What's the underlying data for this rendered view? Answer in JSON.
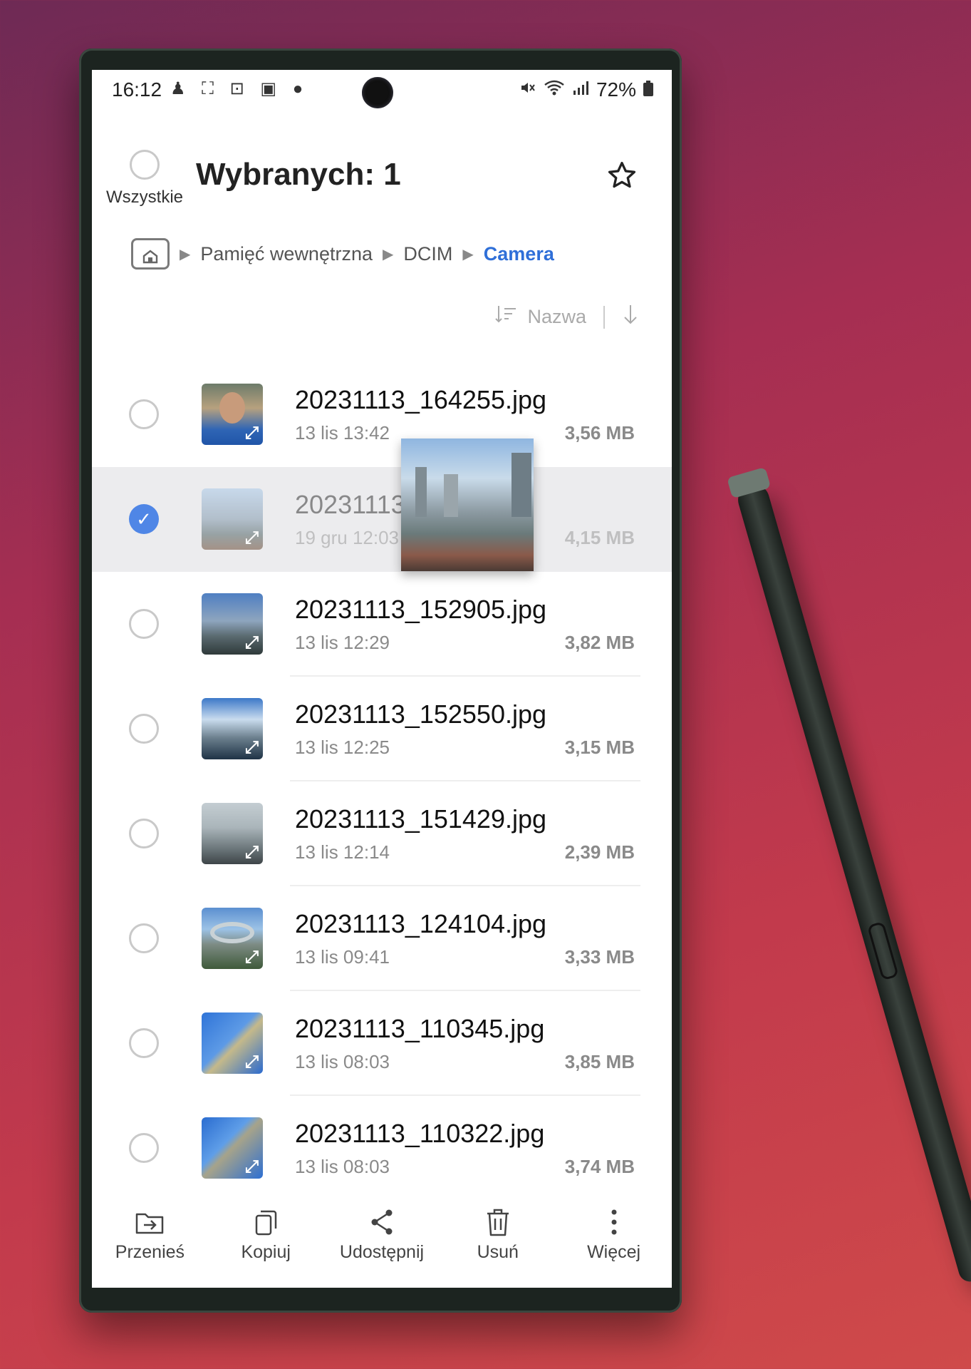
{
  "status": {
    "time": "16:12",
    "icons_left": "♟ ⛶ ⊡ ▣ ●",
    "battery": "72%"
  },
  "header": {
    "select_all_label": "Wszystkie",
    "title": "Wybranych: 1"
  },
  "breadcrumb": {
    "items": [
      "Pamięć wewnętrzna",
      "DCIM",
      "Camera"
    ]
  },
  "sort": {
    "label": "Nazwa"
  },
  "files": [
    {
      "name": "20231113_164255.jpg",
      "date": "13 lis 13:42",
      "size": "3,56 MB",
      "selected": false
    },
    {
      "name": "20231113",
      "date": "19 gru 12:03",
      "size": "4,15 MB",
      "selected": true
    },
    {
      "name": "20231113_152905.jpg",
      "date": "13 lis 12:29",
      "size": "3,82 MB",
      "selected": false
    },
    {
      "name": "20231113_152550.jpg",
      "date": "13 lis 12:25",
      "size": "3,15 MB",
      "selected": false
    },
    {
      "name": "20231113_151429.jpg",
      "date": "13 lis 12:14",
      "size": "2,39 MB",
      "selected": false
    },
    {
      "name": "20231113_124104.jpg",
      "date": "13 lis 09:41",
      "size": "3,33 MB",
      "selected": false
    },
    {
      "name": "20231113_110345.jpg",
      "date": "13 lis 08:03",
      "size": "3,85 MB",
      "selected": false
    },
    {
      "name": "20231113_110322.jpg",
      "date": "13 lis 08:03",
      "size": "3,74 MB",
      "selected": false
    }
  ],
  "bottombar": {
    "move": "Przenieś",
    "copy": "Kopiuj",
    "share": "Udostępnij",
    "delete": "Usuń",
    "more": "Więcej"
  },
  "colors": {
    "accent": "#2f6fd8",
    "checkbox_on": "#4f86e6"
  }
}
